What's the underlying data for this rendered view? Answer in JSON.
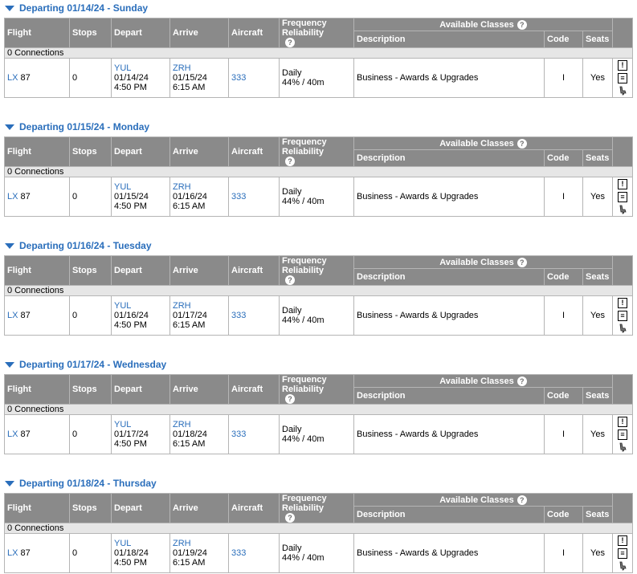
{
  "headers": {
    "flight": "Flight",
    "stops": "Stops",
    "depart": "Depart",
    "arrive": "Arrive",
    "aircraft": "Aircraft",
    "frequency": "Frequency",
    "reliability": "Reliability",
    "available_classes": "Available Classes",
    "description": "Description",
    "code": "Code",
    "seats": "Seats",
    "help_glyph": "?"
  },
  "icons": {
    "info": "!",
    "list": "≡"
  },
  "days": [
    {
      "heading": "Departing 01/14/24 - Sunday",
      "connections": "0 Connections",
      "airline": "LX",
      "flight_no": "87",
      "stops": "0",
      "depart_code": "YUL",
      "depart_date": "01/14/24",
      "depart_time": "4:50 PM",
      "arrive_code": "ZRH",
      "arrive_date": "01/15/24",
      "arrive_time": "6:15 AM",
      "aircraft": "333",
      "frequency": "Daily",
      "reliability": "44% / 40m",
      "description": "Business - Awards & Upgrades",
      "code": "I",
      "seats": "Yes"
    },
    {
      "heading": "Departing 01/15/24 - Monday",
      "connections": "0 Connections",
      "airline": "LX",
      "flight_no": "87",
      "stops": "0",
      "depart_code": "YUL",
      "depart_date": "01/15/24",
      "depart_time": "4:50 PM",
      "arrive_code": "ZRH",
      "arrive_date": "01/16/24",
      "arrive_time": "6:15 AM",
      "aircraft": "333",
      "frequency": "Daily",
      "reliability": "44% / 40m",
      "description": "Business - Awards & Upgrades",
      "code": "I",
      "seats": "Yes"
    },
    {
      "heading": "Departing 01/16/24 - Tuesday",
      "connections": "0 Connections",
      "airline": "LX",
      "flight_no": "87",
      "stops": "0",
      "depart_code": "YUL",
      "depart_date": "01/16/24",
      "depart_time": "4:50 PM",
      "arrive_code": "ZRH",
      "arrive_date": "01/17/24",
      "arrive_time": "6:15 AM",
      "aircraft": "333",
      "frequency": "Daily",
      "reliability": "44% / 40m",
      "description": "Business - Awards & Upgrades",
      "code": "I",
      "seats": "Yes"
    },
    {
      "heading": "Departing 01/17/24 - Wednesday",
      "connections": "0 Connections",
      "airline": "LX",
      "flight_no": "87",
      "stops": "0",
      "depart_code": "YUL",
      "depart_date": "01/17/24",
      "depart_time": "4:50 PM",
      "arrive_code": "ZRH",
      "arrive_date": "01/18/24",
      "arrive_time": "6:15 AM",
      "aircraft": "333",
      "frequency": "Daily",
      "reliability": "44% / 40m",
      "description": "Business - Awards & Upgrades",
      "code": "I",
      "seats": "Yes"
    },
    {
      "heading": "Departing 01/18/24 - Thursday",
      "connections": "0 Connections",
      "airline": "LX",
      "flight_no": "87",
      "stops": "0",
      "depart_code": "YUL",
      "depart_date": "01/18/24",
      "depart_time": "4:50 PM",
      "arrive_code": "ZRH",
      "arrive_date": "01/19/24",
      "arrive_time": "6:15 AM",
      "aircraft": "333",
      "frequency": "Daily",
      "reliability": "44% / 40m",
      "description": "Business - Awards & Upgrades",
      "code": "I",
      "seats": "Yes"
    }
  ]
}
